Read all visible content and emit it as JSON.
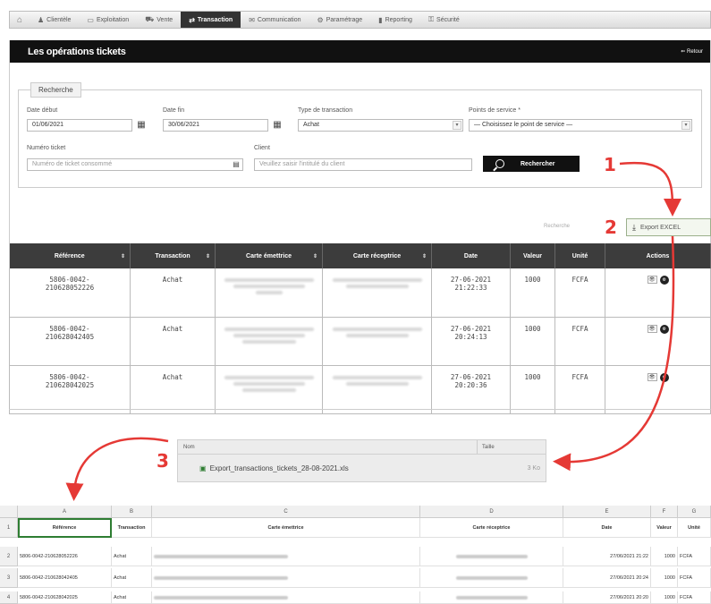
{
  "nav": {
    "tabs": [
      {
        "label": "Clientèle",
        "icon": "people-icon"
      },
      {
        "label": "Exploitation",
        "icon": "folder-icon"
      },
      {
        "label": "Vente",
        "icon": "cart-icon"
      },
      {
        "label": "Transaction",
        "icon": "exchange-icon",
        "active": true
      },
      {
        "label": "Communication",
        "icon": "chat-icon"
      },
      {
        "label": "Paramétrage",
        "icon": "settings-icon"
      },
      {
        "label": "Reporting",
        "icon": "chart-icon"
      },
      {
        "label": "Sécurité",
        "icon": "lock-icon"
      }
    ]
  },
  "page": {
    "title": "Les opérations tickets",
    "back_label": "Retour"
  },
  "search": {
    "legend": "Recherche",
    "date_debut_label": "Date début",
    "date_debut": "01/06/2021",
    "date_fin_label": "Date fin",
    "date_fin": "30/06/2021",
    "type_label": "Type de transaction",
    "type_value": "Achat",
    "point_label": "Points de service *",
    "point_value": "— Choisissez le point de service —",
    "ticket_label": "Numéro ticket",
    "ticket_placeholder": "Numéro de ticket consommé",
    "client_label": "Client",
    "client_placeholder": "Veuillez saisir l'intitulé du client",
    "search_button": "Rechercher"
  },
  "toolbar": {
    "search_label": "Recherche",
    "export_label": "Export EXCEL"
  },
  "table": {
    "headers": [
      "Référence",
      "Transaction",
      "Carte émettrice",
      "Carte réceptrice",
      "Date",
      "Valeur",
      "Unité",
      "Actions"
    ],
    "rows": [
      {
        "ref1": "5806-0042-",
        "ref2": "210628052226",
        "transaction": "Achat",
        "date1": "27-06-2021",
        "date2": "21:22:33",
        "valeur": "1000",
        "unite": "FCFA"
      },
      {
        "ref1": "5806-0042-",
        "ref2": "210628042405",
        "transaction": "Achat",
        "date1": "27-06-2021",
        "date2": "20:24:13",
        "valeur": "1000",
        "unite": "FCFA"
      },
      {
        "ref1": "5806-0042-",
        "ref2": "210628042025",
        "transaction": "Achat",
        "date1": "27-06-2021",
        "date2": "20:20:36",
        "valeur": "1000",
        "unite": "FCFA"
      }
    ]
  },
  "download": {
    "col_name": "Nom",
    "col_size": "Taille",
    "filename": "Export_transactions_tickets_28-08-2021.xls",
    "size": "3 Ko"
  },
  "sheet": {
    "columns": [
      "A",
      "B",
      "C",
      "D",
      "E",
      "F",
      "G"
    ],
    "header": [
      "Référence",
      "Transaction",
      "Carte émettrice",
      "Carte réceptrice",
      "Date",
      "Valeur",
      "Unité"
    ],
    "rows": [
      {
        "num": "2",
        "ref": "5806-0042-210628052226",
        "tr": "Achat",
        "date": "27/06/2021 21:22",
        "val": "1000",
        "unit": "FCFA"
      },
      {
        "num": "3",
        "ref": "5806-0042-210628042405",
        "tr": "Achat",
        "date": "27/06/2021 20:24",
        "val": "1000",
        "unit": "FCFA"
      },
      {
        "num": "4",
        "ref": "5806-0042-210628042025",
        "tr": "Achat",
        "date": "27/06/2021 20:20",
        "val": "1000",
        "unit": "FCFA"
      }
    ],
    "header_row_num": "1"
  },
  "annotations": {
    "step1": "1",
    "step2": "2",
    "step3": "3"
  },
  "colors": {
    "annotation": "#e53935",
    "title_bar": "#111111",
    "table_header": "#3c3c3c",
    "excel_green": "#2e7d32"
  }
}
